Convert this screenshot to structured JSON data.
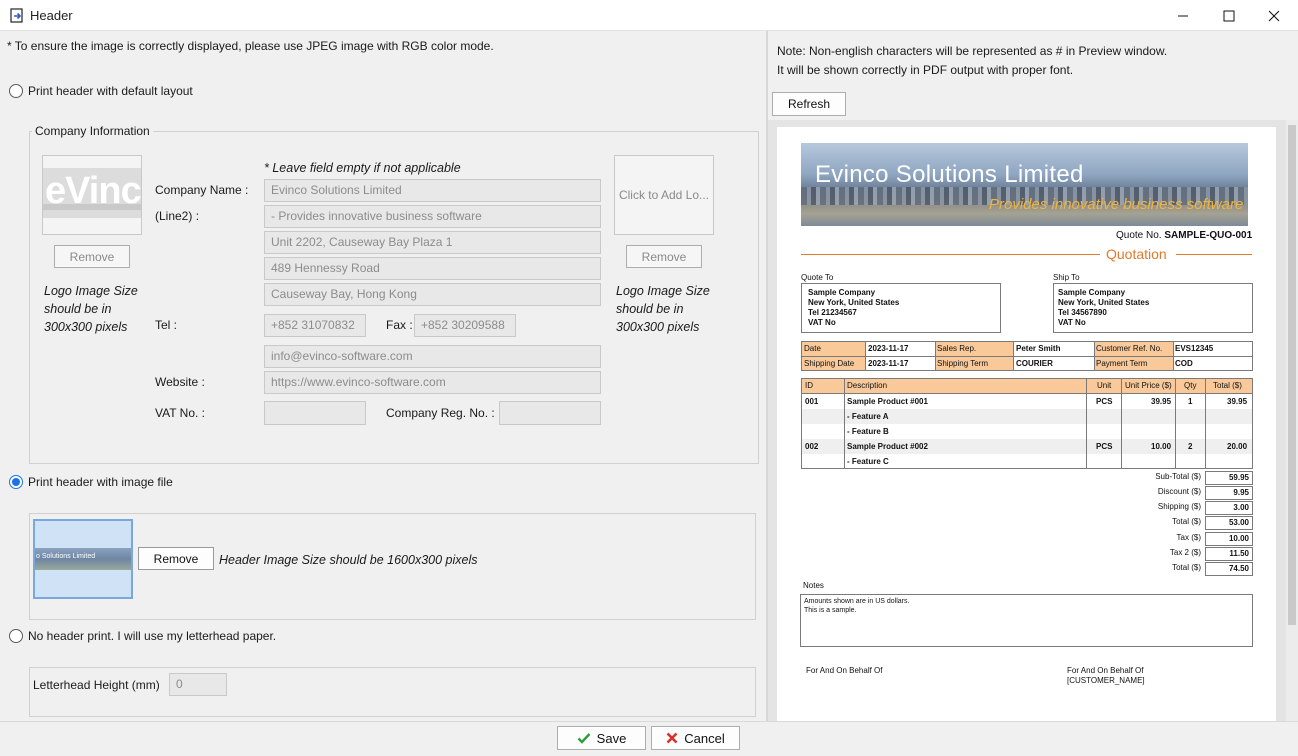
{
  "window": {
    "title": "Header",
    "minimize_icon": "minimize-icon",
    "maximize_icon": "maximize-icon",
    "close_icon": "close-icon"
  },
  "left": {
    "note": "* To ensure the image is correctly displayed, please use JPEG image with RGB color mode.",
    "option_default": "Print header with default layout",
    "company_group_title": "Company Information",
    "leave_empty_note": "* Leave field empty if not applicable",
    "logo_left_text": "eVinco",
    "logo_remove_left": "Remove",
    "logo_size_left": [
      "Logo Image Size",
      "should be in",
      "300x300 pixels"
    ],
    "logo_add_right": "Click to Add Lo...",
    "logo_remove_right": "Remove",
    "logo_size_right": [
      "Logo Image Size",
      "should be in",
      "300x300 pixels"
    ],
    "labels": {
      "company_name": "Company Name :",
      "line2": "(Line2)  :",
      "tel": "Tel :",
      "fax": "Fax :",
      "website": "Website :",
      "vat": "VAT No. :",
      "company_reg": "Company Reg. No. :"
    },
    "fields": {
      "company_name": "Evinco Solutions Limited",
      "line2": "- Provides innovative business software",
      "address1": "Unit 2202, Causeway Bay Plaza 1",
      "address2": "489 Hennessy Road",
      "address3": "Causeway Bay, Hong Kong",
      "tel": "+852 31070832",
      "fax": "+852 30209588",
      "email": "info@evinco-software.com",
      "website": "https://www.evinco-software.com",
      "vat": "",
      "company_reg": ""
    },
    "option_image": "Print header with image file",
    "image_thumb_text": "o Solutions Limited",
    "image_remove": "Remove",
    "image_size_note": "Header Image Size should be 1600x300 pixels",
    "option_none": "No header print. I will use my letterhead paper.",
    "letterhead_label": "Letterhead Height (mm)",
    "letterhead_value": "0"
  },
  "right": {
    "note_line1": "Note: Non-english characters will be represented as # in Preview window.",
    "note_line2": "It will be shown correctly in PDF output with proper font.",
    "refresh": "Refresh",
    "preview": {
      "banner_title": "Evinco Solutions Limited",
      "banner_sub": "Provides innovative business software",
      "quote_no_label": "Quote No.",
      "quote_no": "SAMPLE-QUO-001",
      "doc_title": "Quotation",
      "quote_to_label": "Quote To",
      "ship_to_label": "Ship To",
      "quote_to": [
        "Sample Company",
        "New York, United States",
        "Tel 21234567",
        "VAT No"
      ],
      "ship_to": [
        "Sample Company",
        "New York, United States",
        "Tel 34567890",
        "VAT No"
      ],
      "info": {
        "date_label": "Date",
        "date": "2023-11-17",
        "sales_rep_label": "Sales Rep.",
        "sales_rep": "Peter Smith",
        "cust_ref_label": "Customer Ref. No.",
        "cust_ref": "EVS12345",
        "ship_date_label": "Shipping Date",
        "ship_date": "2023-11-17",
        "ship_term_label": "Shipping Term",
        "ship_term": "COURIER",
        "pay_term_label": "Payment Term",
        "pay_term": "COD"
      },
      "table_headers": [
        "ID",
        "Description",
        "Unit",
        "Unit Price ($)",
        "Qty",
        "Total ($)"
      ],
      "rows": [
        [
          "001",
          "Sample Product #001",
          "PCS",
          "39.95",
          "1",
          "39.95"
        ],
        [
          "",
          "- Feature A",
          "",
          "",
          "",
          ""
        ],
        [
          "",
          "- Feature B",
          "",
          "",
          "",
          ""
        ],
        [
          "002",
          "Sample Product #002",
          "PCS",
          "10.00",
          "2",
          "20.00"
        ],
        [
          "",
          "- Feature C",
          "",
          "",
          "",
          ""
        ]
      ],
      "totals": [
        [
          "Sub-Total ($)",
          "59.95"
        ],
        [
          "Discount ($)",
          "9.95"
        ],
        [
          "Shipping ($)",
          "3.00"
        ],
        [
          "Total ($)",
          "53.00"
        ],
        [
          "Tax ($)",
          "10.00"
        ],
        [
          "Tax 2 ($)",
          "11.50"
        ],
        [
          "Total ($)",
          "74.50"
        ]
      ],
      "notes_label": "Notes",
      "notes_line1": "Amounts shown are in US dollars.",
      "notes_line2": "This is a sample.",
      "sign_left": "For And On Behalf Of",
      "sign_right": "For And On Behalf Of",
      "sign_right_name": "[CUSTOMER_NAME]"
    }
  },
  "bottom": {
    "save": "Save",
    "cancel": "Cancel"
  },
  "colors": {
    "accent": "#1a73e8",
    "quotation_title": "#e07b2c",
    "table_header": "#f9c99a",
    "save_check": "#2e9e3a",
    "cancel_x": "#d9302c"
  }
}
